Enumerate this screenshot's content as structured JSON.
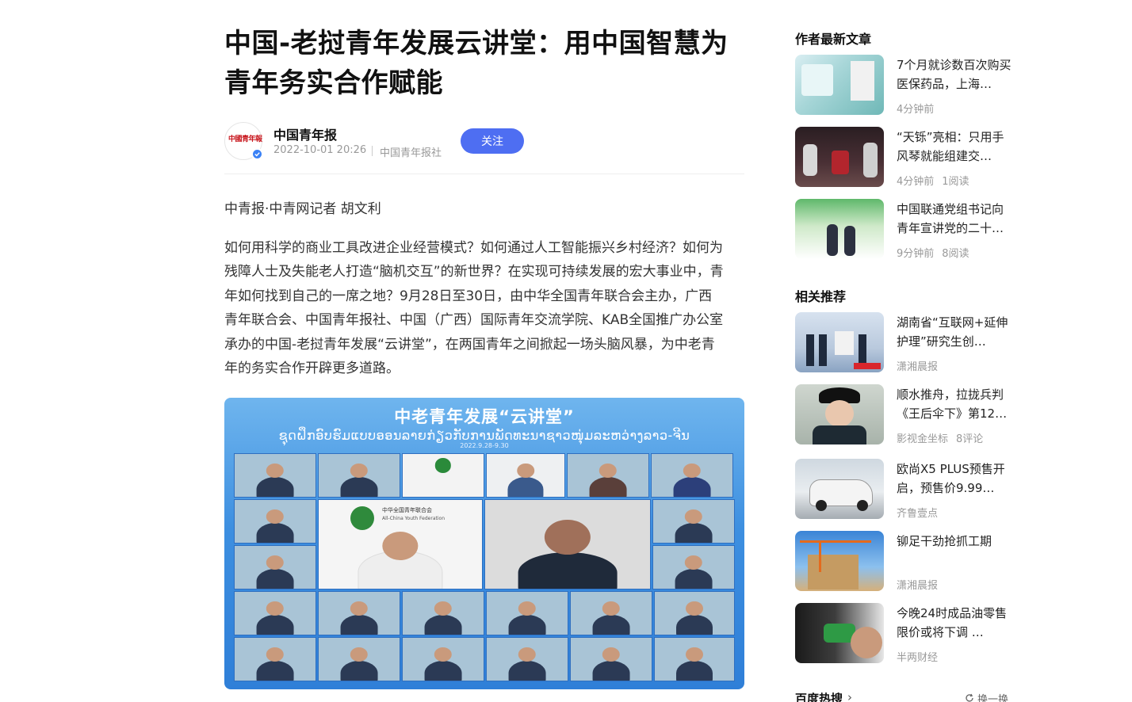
{
  "article": {
    "title": "中国-老挝青年发展云讲堂：用中国智慧为青年务实合作赋能",
    "author": {
      "name": "中国青年报",
      "logo_text": "中國青年報",
      "time": "2022-10-01 20:26",
      "source": "中国青年报社",
      "follow_label": "关注"
    },
    "byline": "中青报·中青网记者 胡文利",
    "paragraph": "如何用科学的商业工具改进企业经营模式？如何通过人工智能振兴乡村经济？如何为残障人士及失能老人打造“脑机交互”的新世界？在实现可持续发展的宏大事业中，青年如何找到自己的一席之地？9月28日至30日，由中华全国青年联合会主办，广西青年联合会、中国青年报社、中国（广西）国际青年交流学院、KAB全国推广办公室承办的中国-老挝青年发展“云讲堂”，在两国青年之间掀起一场头脑风暴，为中老青年的务实合作开辟更多道路。",
    "figure": {
      "title": "中老青年发展“云讲堂”",
      "subtitle": "ຊຸດຝຶກອົບຮົມແບບອອນລາຍກ່ຽວກັບການພັດທະນາຊາວໜຸ່ມລະຫວ່າງລາວ-ຈີນ",
      "date": "2022.9.28-9.30",
      "center_left_label_cn": "中华全国青年联合会",
      "center_left_label_en": "All-China Youth Federation"
    }
  },
  "sidebar": {
    "author_latest_heading": "作者最新文章",
    "author_latest": [
      {
        "title": "7个月就诊数百次购买医保药品，上海…",
        "time": "4分钟前",
        "reads": ""
      },
      {
        "title": "“天铄”亮相：只用手风琴就能组建交…",
        "time": "4分钟前",
        "reads": "1阅读"
      },
      {
        "title": "中国联通党组书记向青年宣讲党的二十…",
        "time": "9分钟前",
        "reads": "8阅读"
      }
    ],
    "related_heading": "相关推荐",
    "related": [
      {
        "title": "湖南省“互联网+延伸护理”研究生创…",
        "source": "潇湘晨报",
        "extra": ""
      },
      {
        "title": "顺水推舟，拉拢兵判《王后伞下》第12…",
        "source": "影视金坐标",
        "extra": "8评论"
      },
      {
        "title": "欧尚X5 PLUS预售开启，预售价9.99…",
        "source": "齐鲁壹点",
        "extra": ""
      },
      {
        "title": "铆足干劲抢抓工期",
        "source": "潇湘晨报",
        "extra": ""
      },
      {
        "title": "今晚24时成品油零售限价或将下调 …",
        "source": "半两财经",
        "extra": ""
      }
    ],
    "hot_heading": "百度热搜",
    "hot_chevron": "›",
    "refresh_label": "换一换"
  }
}
